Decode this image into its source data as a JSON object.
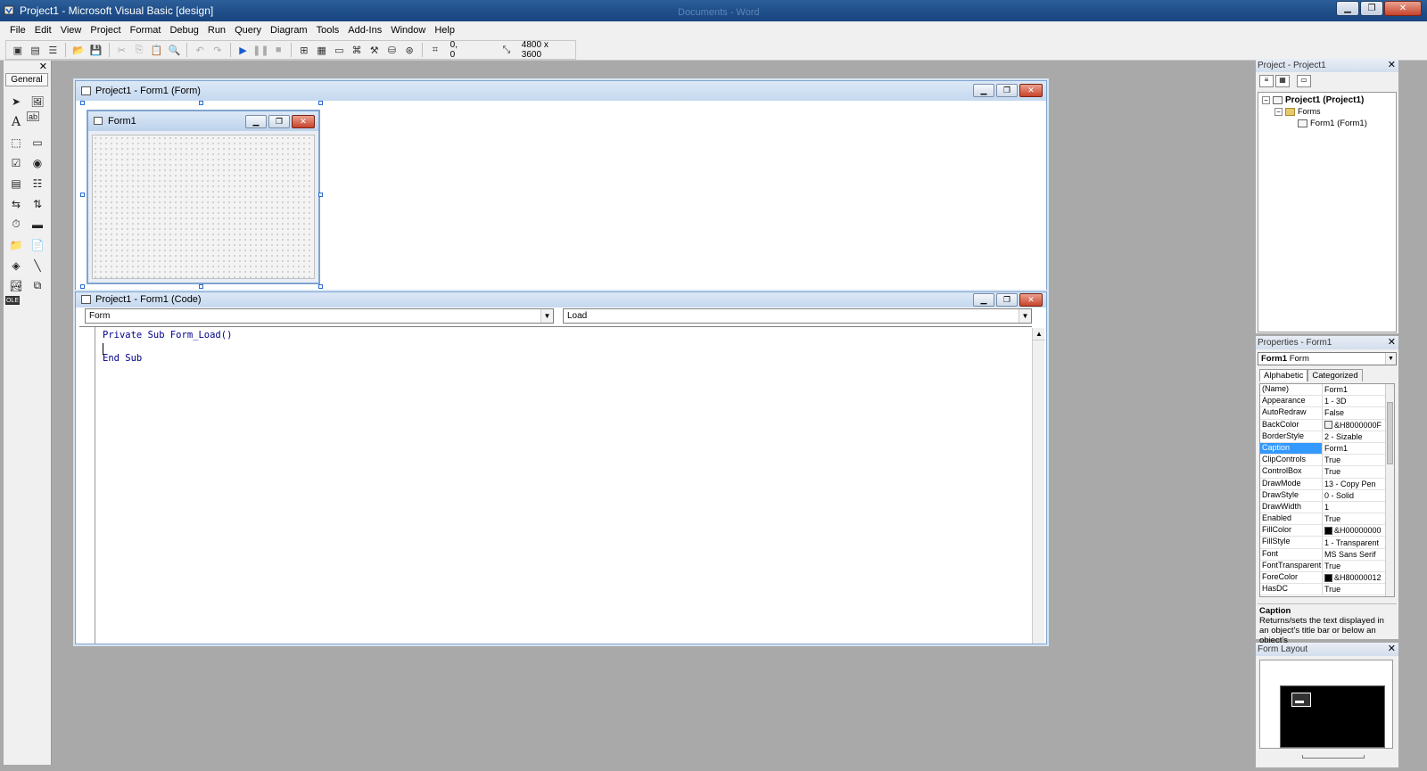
{
  "window": {
    "title": "Project1 - Microsoft Visual Basic [design]",
    "ghost_title": "Documents - Word",
    "min": "▁",
    "max": "❐",
    "close": "✕"
  },
  "menu": [
    "File",
    "Edit",
    "View",
    "Project",
    "Format",
    "Debug",
    "Run",
    "Query",
    "Diagram",
    "Tools",
    "Add-Ins",
    "Window",
    "Help"
  ],
  "toolbar": {
    "position": "0, 0",
    "size": "4800 x 3600"
  },
  "toolbox": {
    "tab": "General",
    "close": "✕"
  },
  "form_designer": {
    "title": "Project1 - Form1 (Form)",
    "form_caption": "Form1"
  },
  "code_window": {
    "title": "Project1 - Form1 (Code)",
    "object_combo": "Form",
    "proc_combo": "Load",
    "lines": [
      "Private Sub Form_Load()",
      "End Sub"
    ]
  },
  "project_panel": {
    "title": "Project - Project1",
    "close": "✕",
    "root": "Project1 (Project1)",
    "folder": "Forms",
    "item": "Form1 (Form1)"
  },
  "properties_panel": {
    "title": "Properties - Form1",
    "close": "✕",
    "object_name": "Form1",
    "object_type": "Form",
    "tabs": [
      "Alphabetic",
      "Categorized"
    ],
    "rows": [
      {
        "name": "(Name)",
        "value": "Form1"
      },
      {
        "name": "Appearance",
        "value": "1 - 3D"
      },
      {
        "name": "AutoRedraw",
        "value": "False"
      },
      {
        "name": "BackColor",
        "value": "&H8000000F",
        "swatch": "#f0f0f0"
      },
      {
        "name": "BorderStyle",
        "value": "2 - Sizable"
      },
      {
        "name": "Caption",
        "value": "Form1",
        "selected": true
      },
      {
        "name": "ClipControls",
        "value": "True"
      },
      {
        "name": "ControlBox",
        "value": "True"
      },
      {
        "name": "DrawMode",
        "value": "13 - Copy Pen"
      },
      {
        "name": "DrawStyle",
        "value": "0 - Solid"
      },
      {
        "name": "DrawWidth",
        "value": "1"
      },
      {
        "name": "Enabled",
        "value": "True"
      },
      {
        "name": "FillColor",
        "value": "&H00000000",
        "swatch": "#000000"
      },
      {
        "name": "FillStyle",
        "value": "1 - Transparent"
      },
      {
        "name": "Font",
        "value": "MS Sans Serif"
      },
      {
        "name": "FontTransparent",
        "value": "True"
      },
      {
        "name": "ForeColor",
        "value": "&H80000012",
        "swatch": "#000000"
      },
      {
        "name": "HasDC",
        "value": "True"
      }
    ],
    "desc_title": "Caption",
    "desc_text": "Returns/sets the text displayed in an object's title bar or below an object's"
  },
  "layout_panel": {
    "title": "Form Layout",
    "close": "✕"
  },
  "colors": {
    "titlebar": "#1f4f8a",
    "selection": "#3399ff",
    "code_keyword": "#00008b"
  }
}
